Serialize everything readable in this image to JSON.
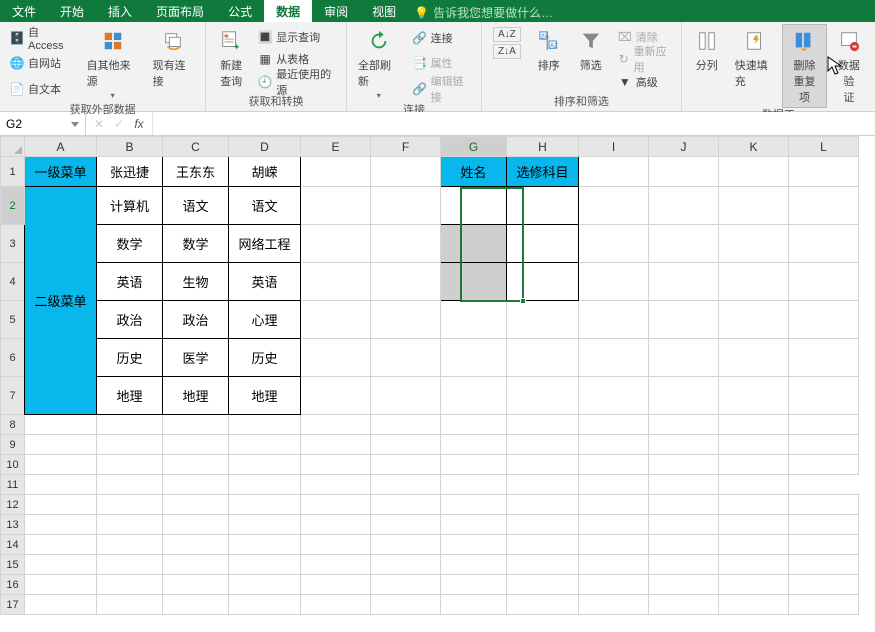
{
  "tabs": {
    "items": [
      "文件",
      "开始",
      "插入",
      "页面布局",
      "公式",
      "数据",
      "审阅",
      "视图"
    ],
    "active_index": 5,
    "tell_label": "告诉我您想要做什么…"
  },
  "ribbon": {
    "ext_group": {
      "access": "自 Access",
      "web": "自网站",
      "text": "自文本",
      "other": "自其他来源",
      "existing": "现有连接",
      "label": "获取外部数据"
    },
    "transform_group": {
      "new_query": "新建\n查询",
      "show_query": "显示查询",
      "from_table": "从表格",
      "recent": "最近使用的源",
      "label": "获取和转换"
    },
    "conn_group": {
      "refresh": "全部刷新",
      "connections": "连接",
      "properties": "属性",
      "edit_links": "编辑链接",
      "label": "连接"
    },
    "sort_group": {
      "sort": "排序",
      "filter": "筛选",
      "clear": "清除",
      "reapply": "重新应用",
      "advanced": "高级",
      "label": "排序和筛选"
    },
    "tools_group": {
      "text_to_col": "分列",
      "flash_fill": "快速填充",
      "remove_dup": "删除\n重复项",
      "validation": "数据验\n证",
      "label": "数据工"
    }
  },
  "namebox": "G2",
  "fx_label": "fx",
  "sheet": {
    "cols": [
      "A",
      "B",
      "C",
      "D",
      "E",
      "F",
      "G",
      "H",
      "I",
      "J",
      "K",
      "L"
    ],
    "a1": "一级菜单",
    "b1": "张迅捷",
    "c1": "王东东",
    "d1": "胡嵘",
    "a2": "二级菜单",
    "b2": "计算机",
    "c2": "语文",
    "d2": "语文",
    "b3": "数学",
    "c3": "数学",
    "d3": "网络工程",
    "b4": "英语",
    "c4": "生物",
    "d4": "英语",
    "b5": "政治",
    "c5": "政治",
    "d5": "心理",
    "b6": "历史",
    "c6": "医学",
    "d6": "历史",
    "b7": "地理",
    "c7": "地理",
    "d7": "地理",
    "g1": "姓名",
    "h1": "选修科目",
    "active_cell": "G2",
    "row_count": 17
  },
  "chart_data": {
    "type": "table",
    "title": "",
    "headers_row": [
      "一级菜单",
      "张迅捷",
      "王东东",
      "胡嵘"
    ],
    "side_header": "二级菜单",
    "rows": [
      [
        "计算机",
        "语文",
        "语文"
      ],
      [
        "数学",
        "数学",
        "网络工程"
      ],
      [
        "英语",
        "生物",
        "英语"
      ],
      [
        "政治",
        "政治",
        "心理"
      ],
      [
        "历史",
        "医学",
        "历史"
      ],
      [
        "地理",
        "地理",
        "地理"
      ]
    ],
    "lookup_headers": [
      "姓名",
      "选修科目"
    ]
  }
}
